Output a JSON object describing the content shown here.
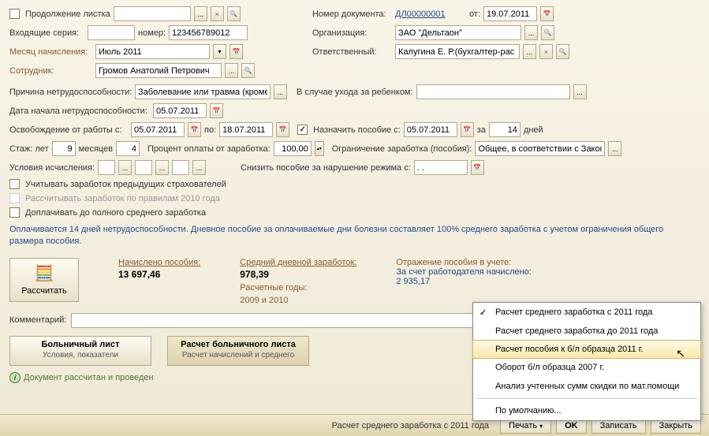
{
  "header": {
    "continuation_label": "Продолжение листка",
    "doc_num_label": "Номер документа:",
    "doc_num": "ДЛ00000001",
    "from_label": "от:",
    "doc_date": "19.07.2011",
    "incoming_series_label": "Входящие серия:",
    "num_label": "номер:",
    "num_value": "123456789012",
    "org_label": "Организация:",
    "org_value": "ЗАО \"Дельтаон\"",
    "month_label": "Месяц начисления:",
    "month_value": "Июль 2011",
    "responsible_label": "Ответственный:",
    "responsible_value": "Калугина Е. Р.(бухгалтер-рас",
    "employee_label": "Сотрудник:",
    "employee_value": "Громов Анатолий Петрович"
  },
  "reason": {
    "label": "Причина нетрудоспособности:",
    "value": "Заболевание или травма (кроме",
    "child_care_label": "В случае ухода за ребенком:"
  },
  "dates": {
    "start_label": "Дата начала нетрудоспособности:",
    "start_value": "05.07.2011",
    "release_label": "Освобождение от работы с:",
    "release_from": "05.07.2011",
    "to_label": "по:",
    "release_to": "18.07.2011",
    "assign_label": "Назначить пособие с:",
    "assign_from": "05.07.2011",
    "for_label": "за",
    "days": "14",
    "days_label": "дней"
  },
  "service": {
    "stage_label": "Стаж: лет",
    "years": "9",
    "months_label": "месяцев",
    "months": "4",
    "percent_label": "Процент оплаты от заработка:",
    "percent": "100,00",
    "limit_label": "Ограничение заработка (пособия):",
    "limit_value": "Общее, в соответствии с Закон"
  },
  "conditions": {
    "label": "Условия исчисления:",
    "reduce_label": "Снизить пособие за нарушение режима с:",
    "reduce_value": ". ."
  },
  "checkboxes": {
    "prev_insurers": "Учитывать заработок предыдущих страхователей",
    "rules_2010": "Рассчитывать заработок по правилам 2010 года",
    "full_average": "Доплачивать до полного среднего заработка"
  },
  "info_text": "Оплачивается 14 дней нетрудоспособности. Дневное пособие за оплачиваемые дни болезни составляет 100% среднего заработка с учетом ограничения общего размера пособия.",
  "calc_button": "Рассчитать",
  "summary": {
    "accrued_label": "Начислено пособия:",
    "accrued_value": "13 697,46",
    "avg_daily_label": "Средний дневной заработок:",
    "avg_daily_value": "978,39",
    "calc_years_label": "Расчетные годы:",
    "calc_years_value": "2009 и 2010",
    "reflection_label": "Отражение пособия в учете:",
    "employer_label": "За счет работодателя начислено:",
    "employer_value": "2 935,17"
  },
  "comment_label": "Комментарий:",
  "tabs": {
    "tab1_title": "Больничный лист",
    "tab1_sub": "Условия, показатели",
    "tab2_title": "Расчет больничного листа",
    "tab2_sub": "Расчет начислений и среднего"
  },
  "status": "Документ рассчитан и проведен",
  "footer": {
    "variant": "Расчет среднего заработка с 2011 года",
    "print": "Печать",
    "ok": "OK",
    "save": "Записать",
    "close": "Закрыть"
  },
  "menu": {
    "item1": "Расчет среднего заработка с 2011 года",
    "item2": "Расчет среднего заработка до 2011 года",
    "item3": "Расчет пособия к б/л образца 2011 г.",
    "item4": "Оборот б/л образца 2007 г.",
    "item5": "Анализ учтенных сумм скидки по мат.помощи",
    "item6": "По умолчанию..."
  }
}
